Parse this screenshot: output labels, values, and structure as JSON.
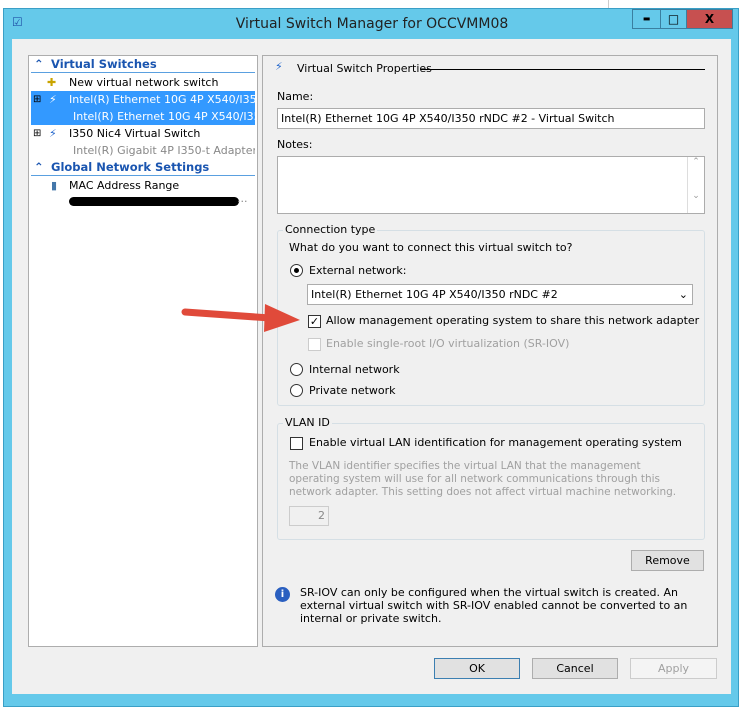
{
  "window": {
    "title": "Virtual Switch Manager for OCCVMM08",
    "minimize": "▬",
    "restore": "□",
    "close": "X"
  },
  "sidebar": {
    "virtual_switches_header": "Virtual Switches",
    "new_switch": "New virtual network switch",
    "switches": [
      {
        "name": "Intel(R) Ethernet 10G 4P X540/I35...",
        "adapter": "Intel(R) Ethernet 10G 4P X540/I35...",
        "selected": true
      },
      {
        "name": "I350 Nic4 Virtual Switch",
        "adapter": "Intel(R) Gigabit 4P I350-t Adapter ...",
        "selected": false
      }
    ],
    "global_header": "Global Network Settings",
    "mac_range": "MAC Address Range",
    "mac_value_ellipsis": "..."
  },
  "props": {
    "section_title": "Virtual Switch Properties",
    "name_label": "Name:",
    "name_value": "Intel(R) Ethernet 10G 4P X540/I350 rNDC #2 - Virtual Switch",
    "notes_label": "Notes:",
    "notes_value": "",
    "connection_type": "Connection type",
    "question": "What do you want to connect this virtual switch to?",
    "external": "External network:",
    "adapter_selected": "Intel(R) Ethernet 10G 4P X540/I350 rNDC #2",
    "allow_mgmt": "Allow management operating system to share this network adapter",
    "sriov": "Enable single-root I/O virtualization (SR-IOV)",
    "internal": "Internal network",
    "private": "Private network",
    "vlan_title": "VLAN ID",
    "vlan_enable": "Enable virtual LAN identification for management operating system",
    "vlan_desc": "The VLAN identifier specifies the virtual LAN that the management operating system will use for all network communications through this network adapter. This setting does not affect virtual machine networking.",
    "vlan_value": "2",
    "remove": "Remove",
    "info": "SR-IOV can only be configured when the virtual switch is created. An external virtual switch with SR-IOV enabled cannot be converted to an internal or private switch."
  },
  "buttons": {
    "ok": "OK",
    "cancel": "Cancel",
    "apply": "Apply"
  },
  "colors": {
    "titlebar": "#65c9ea",
    "close": "#c75050",
    "selection": "#3399ff",
    "annotation_arrow": "#e04a3a"
  }
}
